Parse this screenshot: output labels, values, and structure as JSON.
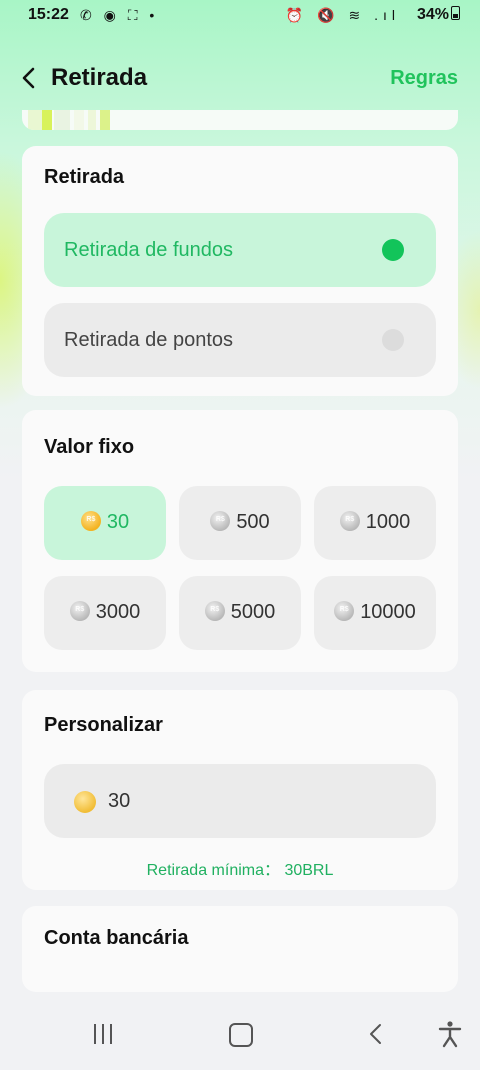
{
  "status_bar": {
    "time": "15:22",
    "left_icons": "✆ ◉ ⛶ •",
    "right_icons": "⏰ 🔇 ≋ .ıl",
    "battery": "34%"
  },
  "header": {
    "title": "Retirada",
    "rules_label": "Regras"
  },
  "withdraw_type": {
    "title": "Retirada",
    "options": [
      {
        "label": "Retirada de fundos",
        "selected": true
      },
      {
        "label": "Retirada de pontos",
        "selected": false
      }
    ]
  },
  "fixed_value": {
    "title": "Valor fixo",
    "chips": [
      {
        "amount": "30",
        "selected": true
      },
      {
        "amount": "500",
        "selected": false
      },
      {
        "amount": "1000",
        "selected": false
      },
      {
        "amount": "3000",
        "selected": false
      },
      {
        "amount": "5000",
        "selected": false
      },
      {
        "amount": "10000",
        "selected": false
      }
    ]
  },
  "custom": {
    "title": "Personalizar",
    "value": "30",
    "min_note": "Retirada mínima： 30BRL"
  },
  "bank": {
    "title": "Conta bancária"
  },
  "colors": {
    "accent": "#20c35c",
    "selected_bg": "#c8f5da",
    "unselected_bg": "#ededed"
  },
  "icons": [
    "back-arrow-icon",
    "coin-icon",
    "recent-apps-icon",
    "home-icon",
    "nav-back-icon",
    "accessibility-icon"
  ]
}
